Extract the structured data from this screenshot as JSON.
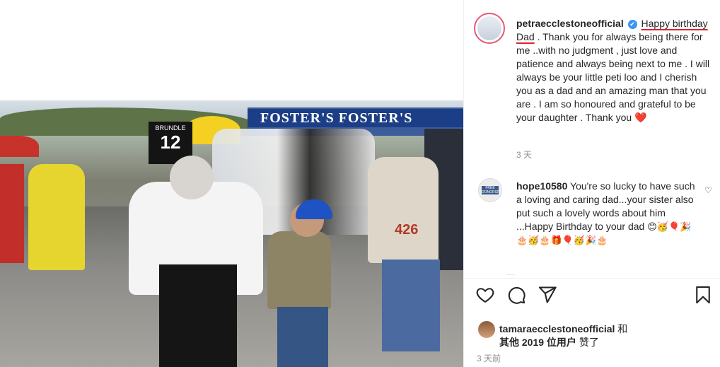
{
  "post": {
    "username": "petraecclestoneofficial",
    "verified_icon": "✔",
    "caption_underlined": "Happy birthday Dad",
    "caption_rest": " . Thank you for always being there for me ..with no judgment , just love and patience and always being next to me . I will always be your little peti loo and I cherish you as a dad and an amazing man that you are . I am so honoured and grateful to be your daughter . Thank you",
    "caption_heart": "❤️",
    "caption_time": "3 天"
  },
  "video": {
    "banner_text": "FOSTER'S  FOSTER'S",
    "board_name": "BRUNDLE",
    "board_number": "12",
    "vest_number": "426"
  },
  "comment": {
    "username": "hope10580",
    "avatar_tag": "FREE DONORSFT",
    "text": " You're so lucky to have such a loving and caring dad...your sister also put such a lovely words about him ...Happy Birthday to your dad ",
    "emojis": "😊🥳🎈🎉🎂🥳🎂🎁🎈🥳🎉🎂",
    "like_icon": "♡",
    "partial_row": "…"
  },
  "actions": {
    "like_icon": "heart-outline-icon",
    "comment_icon": "comment-bubble-icon",
    "share_icon": "paper-plane-icon",
    "save_icon": "bookmark-icon"
  },
  "likes": {
    "liker_name": "tamaraecclestoneofficial",
    "connector": " 和",
    "others_text": "其他 2019 位用户",
    "suffix": " 赞了"
  },
  "post_time": "3 天前",
  "colors": {
    "accent_underline": "#e0242b",
    "verified_blue": "#3897f0",
    "heart_red": "#ed4956",
    "story_ring": "#e35a7a"
  }
}
